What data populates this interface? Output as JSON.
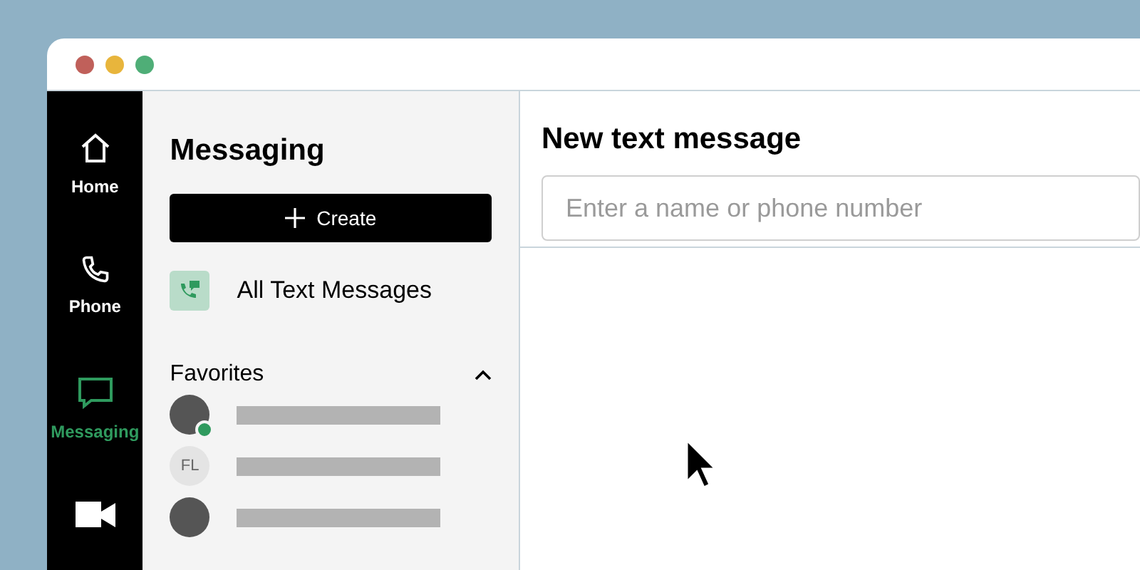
{
  "nav": [
    {
      "label": "Home",
      "kind": "home",
      "selected": false
    },
    {
      "label": "Phone",
      "kind": "phone",
      "selected": false
    },
    {
      "label": "Messaging",
      "kind": "messaging",
      "selected": true
    },
    {
      "kind": "video",
      "selected": false
    }
  ],
  "sidebar": {
    "title": "Messaging",
    "create_button": "Create",
    "all_messages": "All Text Messages",
    "favorites": {
      "title": "Favorites",
      "expanded": true,
      "items": [
        {
          "kind": "photo",
          "online": true
        },
        {
          "kind": "initials",
          "initials": "FL",
          "online": false
        },
        {
          "kind": "photo",
          "online": false
        }
      ]
    }
  },
  "main": {
    "title": "New text message",
    "recipient": {
      "placeholder": "Enter a name or phone number"
    }
  }
}
